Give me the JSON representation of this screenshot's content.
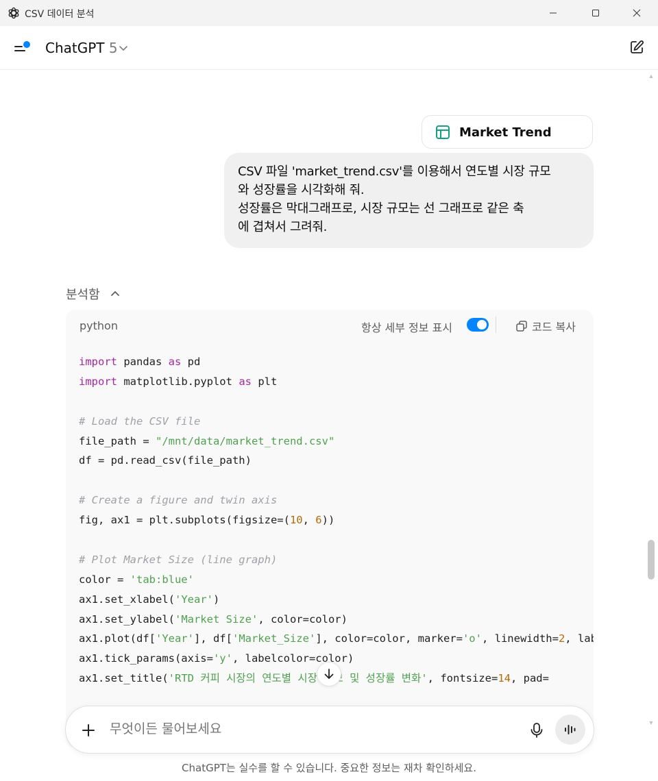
{
  "window": {
    "title": "CSV 데이터 분석"
  },
  "header": {
    "model_name": "ChatGPT",
    "model_version": "5"
  },
  "attachment": {
    "name": "Market Trend",
    "icon": "spreadsheet-icon",
    "accent": "#10a37f"
  },
  "user_message": {
    "text": "CSV 파일 'market_trend.csv'를 이용해서 연도별 시장 규모\n와 성장률을 시각화해 줘.\n성장률은 막대그래프로, 시장 규모는 선 그래프로 같은 축\n에 겹쳐서 그려줘."
  },
  "analysis": {
    "label": "분석함"
  },
  "code_block": {
    "language": "python",
    "detail_toggle_label": "항상 세부 정보 표시",
    "detail_toggle_on": true,
    "copy_label": "코드 복사",
    "toggle_color": "#0285ff",
    "lines": [
      [
        {
          "t": "import",
          "c": "kw"
        },
        {
          "t": " pandas "
        },
        {
          "t": "as",
          "c": "kw"
        },
        {
          "t": " pd"
        }
      ],
      [
        {
          "t": "import",
          "c": "kw"
        },
        {
          "t": " matplotlib.pyplot "
        },
        {
          "t": "as",
          "c": "kw"
        },
        {
          "t": " plt"
        }
      ],
      [],
      [
        {
          "t": "# Load the CSV file",
          "c": "cmt"
        }
      ],
      [
        {
          "t": "file_path = "
        },
        {
          "t": "\"/mnt/data/market_trend.csv\"",
          "c": "str"
        }
      ],
      [
        {
          "t": "df = pd.read_csv(file_path)"
        }
      ],
      [],
      [
        {
          "t": "# Create a figure and twin axis",
          "c": "cmt"
        }
      ],
      [
        {
          "t": "fig, ax1 = plt.subplots(figsize=("
        },
        {
          "t": "10",
          "c": "num"
        },
        {
          "t": ", "
        },
        {
          "t": "6",
          "c": "num"
        },
        {
          "t": "))"
        }
      ],
      [],
      [
        {
          "t": "# Plot Market Size (line graph)",
          "c": "cmt"
        }
      ],
      [
        {
          "t": "color = "
        },
        {
          "t": "'tab:blue'",
          "c": "str"
        }
      ],
      [
        {
          "t": "ax1.set_xlabel("
        },
        {
          "t": "'Year'",
          "c": "str"
        },
        {
          "t": ")"
        }
      ],
      [
        {
          "t": "ax1.set_ylabel("
        },
        {
          "t": "'Market Size'",
          "c": "str"
        },
        {
          "t": ", color=color)"
        }
      ],
      [
        {
          "t": "ax1.plot(df["
        },
        {
          "t": "'Year'",
          "c": "str"
        },
        {
          "t": "], df["
        },
        {
          "t": "'Market_Size'",
          "c": "str"
        },
        {
          "t": "], color=color, marker="
        },
        {
          "t": "'o'",
          "c": "str"
        },
        {
          "t": ", linewidth="
        },
        {
          "t": "2",
          "c": "num"
        },
        {
          "t": ", lab"
        }
      ],
      [
        {
          "t": "ax1.tick_params(axis="
        },
        {
          "t": "'y'",
          "c": "str"
        },
        {
          "t": ", labelcolor=color)"
        }
      ],
      [
        {
          "t": "ax1.set_title("
        },
        {
          "t": "'RTD 커피 시장의 연도별 시장 규모 및 성장률 변화'",
          "c": "str"
        },
        {
          "t": ", fontsize="
        },
        {
          "t": "14",
          "c": "num"
        },
        {
          "t": ", pad="
        }
      ]
    ]
  },
  "composer": {
    "placeholder": "무엇이든 물어보세요"
  },
  "footer": {
    "disclaimer": "ChatGPT는 실수를 할 수 있습니다. 중요한 정보는 재차 확인하세요."
  },
  "icons": {
    "app": "openai-logo-icon",
    "sidebar": "sidebar-toggle-icon",
    "new_chat": "edit-icon",
    "copy": "copy-icon",
    "scroll": "arrow-down-icon",
    "add": "plus-icon",
    "mic": "mic-icon",
    "voice": "voice-wave-icon"
  }
}
